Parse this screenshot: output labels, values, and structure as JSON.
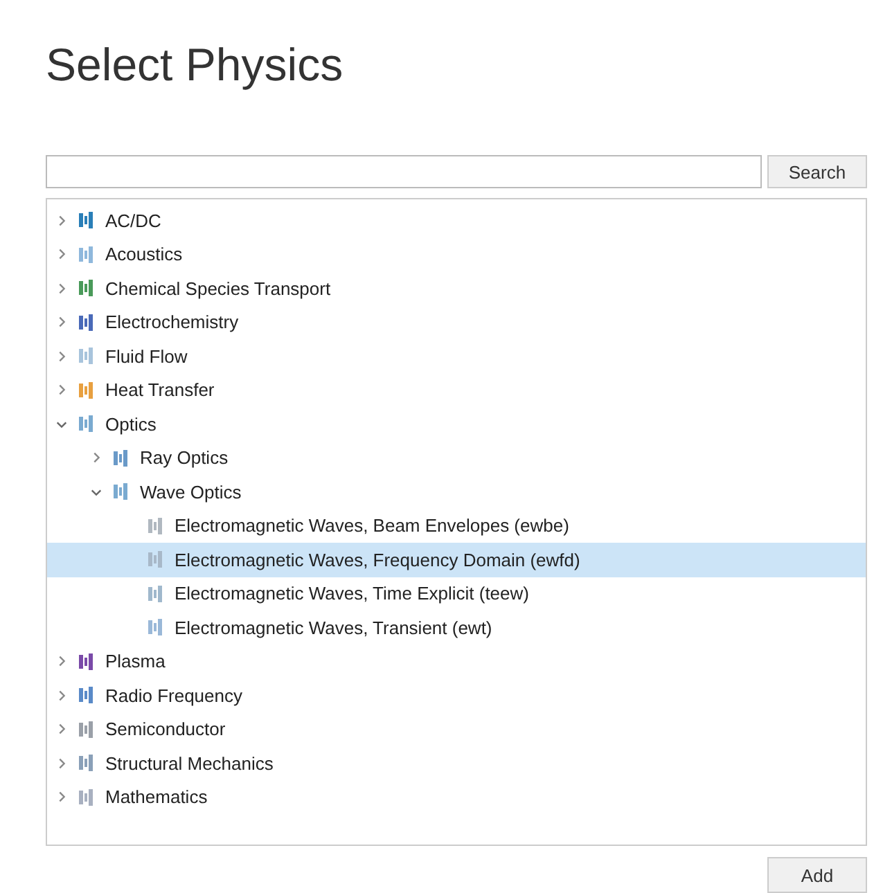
{
  "title": "Select Physics",
  "search": {
    "button": "Search"
  },
  "tree": [
    {
      "label": "AC/DC",
      "color": "#2a7fb8",
      "expanded": false,
      "selected": false
    },
    {
      "label": "Acoustics",
      "color": "#8fb8dc",
      "expanded": false,
      "selected": false
    },
    {
      "label": "Chemical Species Transport",
      "color": "#4a9a5a",
      "expanded": false,
      "selected": false
    },
    {
      "label": "Electrochemistry",
      "color": "#4a6ab8",
      "expanded": false,
      "selected": false
    },
    {
      "label": "Fluid Flow",
      "color": "#a8c4dc",
      "expanded": false,
      "selected": false
    },
    {
      "label": "Heat Transfer",
      "color": "#e8a040",
      "expanded": false,
      "selected": false
    },
    {
      "label": "Optics",
      "color": "#7aaad0",
      "expanded": true,
      "selected": false,
      "children": [
        {
          "label": "Ray Optics",
          "color": "#6a9ac8",
          "expanded": false,
          "selected": false
        },
        {
          "label": "Wave Optics",
          "color": "#7aaad0",
          "expanded": true,
          "selected": false,
          "children": [
            {
              "label": "Electromagnetic Waves, Beam Envelopes (ewbe)",
              "color": "#b0b8c0",
              "selected": false
            },
            {
              "label": "Electromagnetic Waves, Frequency Domain (ewfd)",
              "color": "#a8b8c8",
              "selected": true
            },
            {
              "label": "Electromagnetic Waves, Time Explicit (teew)",
              "color": "#a0b8cc",
              "selected": false
            },
            {
              "label": "Electromagnetic Waves, Transient (ewt)",
              "color": "#9ab8d8",
              "selected": false
            }
          ]
        }
      ]
    },
    {
      "label": "Plasma",
      "color": "#7a4aa8",
      "expanded": false,
      "selected": false
    },
    {
      "label": "Radio Frequency",
      "color": "#5a8ac8",
      "expanded": false,
      "selected": false
    },
    {
      "label": "Semiconductor",
      "color": "#9aa0a8",
      "expanded": false,
      "selected": false
    },
    {
      "label": "Structural Mechanics",
      "color": "#8aa0b8",
      "expanded": false,
      "selected": false
    },
    {
      "label": "Mathematics",
      "color": "#a8b0c0",
      "expanded": false,
      "selected": false
    }
  ],
  "add_button": "Add"
}
